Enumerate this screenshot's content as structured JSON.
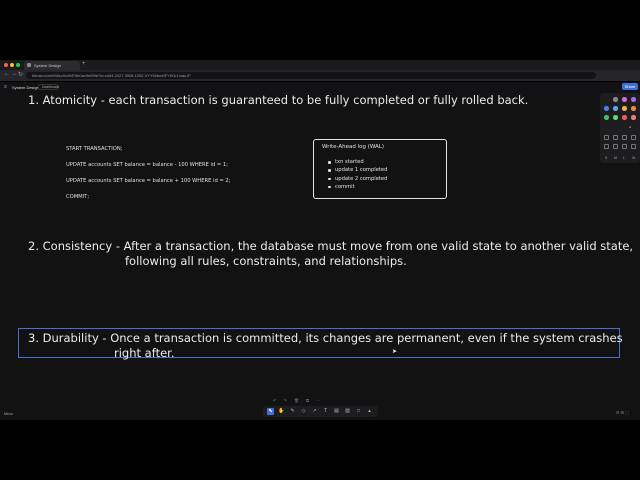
{
  "browser": {
    "tab_title": "System Design",
    "new_tab": "+",
    "url": "tldraw.com/f/b8cc0c96f70b0ac9e5f9e?d=v444.2027.3908.1052.VYYk5bm0FYKDrL/xac.iF",
    "nav": {
      "back": "←",
      "forward": "→",
      "reload": "↻"
    }
  },
  "app": {
    "menu_icon": "≡",
    "title": "System Design",
    "dashboard_label": "Dashboard",
    "share_label": "Share"
  },
  "canvas": {
    "atomicity": {
      "number": "1.",
      "text": "Atomicity - each transaction is guaranteed to be fully completed or fully rolled back."
    },
    "sql_lines": [
      "START TRANSACTION;",
      "UPDATE accounts SET balance = balance - 100 WHERE id = 1;",
      "UPDATE accounts SET balance = balance + 100 WHERE id = 2;",
      "COMMIT;"
    ],
    "wal": {
      "title": "Write-Ahead log (WAL)",
      "items": [
        "txn started",
        "update 1 completed",
        "update 2 completed",
        "commit"
      ]
    },
    "consistency": {
      "number": "2.",
      "line1": "Consistency -  After a transaction, the database must move from one valid state to another valid state,",
      "line2": "following all rules, constraints, and relationships."
    },
    "durability": {
      "number": "3.",
      "line1": "Durability -  Once a transaction is committed, its changes are permanent, even if the system crashes",
      "line2": "right after."
    }
  },
  "style_panel": {
    "colors": [
      "#1e1e1e",
      "#8a8a8a",
      "#d36bd6",
      "#a36bf0",
      "#4f7ff0",
      "#5aa8f0",
      "#f0b43a",
      "#f08a3a",
      "#3fbf6a",
      "#6ad36a",
      "#f05a5a",
      "#f07a7a"
    ],
    "sizes": [
      "S",
      "M",
      "L",
      "XL"
    ]
  },
  "toolbar": {
    "tools": [
      "select-icon",
      "hand-icon",
      "draw-icon",
      "eraser-icon",
      "arrow-icon",
      "text-icon",
      "note-icon",
      "image-icon",
      "rectangle-icon",
      "more-icon"
    ],
    "glyphs": [
      "⬉",
      "✋",
      "✎",
      "◇",
      "↗",
      "T",
      "▤",
      "▨",
      "□",
      "▴"
    ],
    "undo_row": [
      "↶",
      "↷",
      "🗑",
      "⧉",
      "⋯"
    ]
  },
  "zoom": {
    "label": "Menu",
    "minus": "-"
  }
}
